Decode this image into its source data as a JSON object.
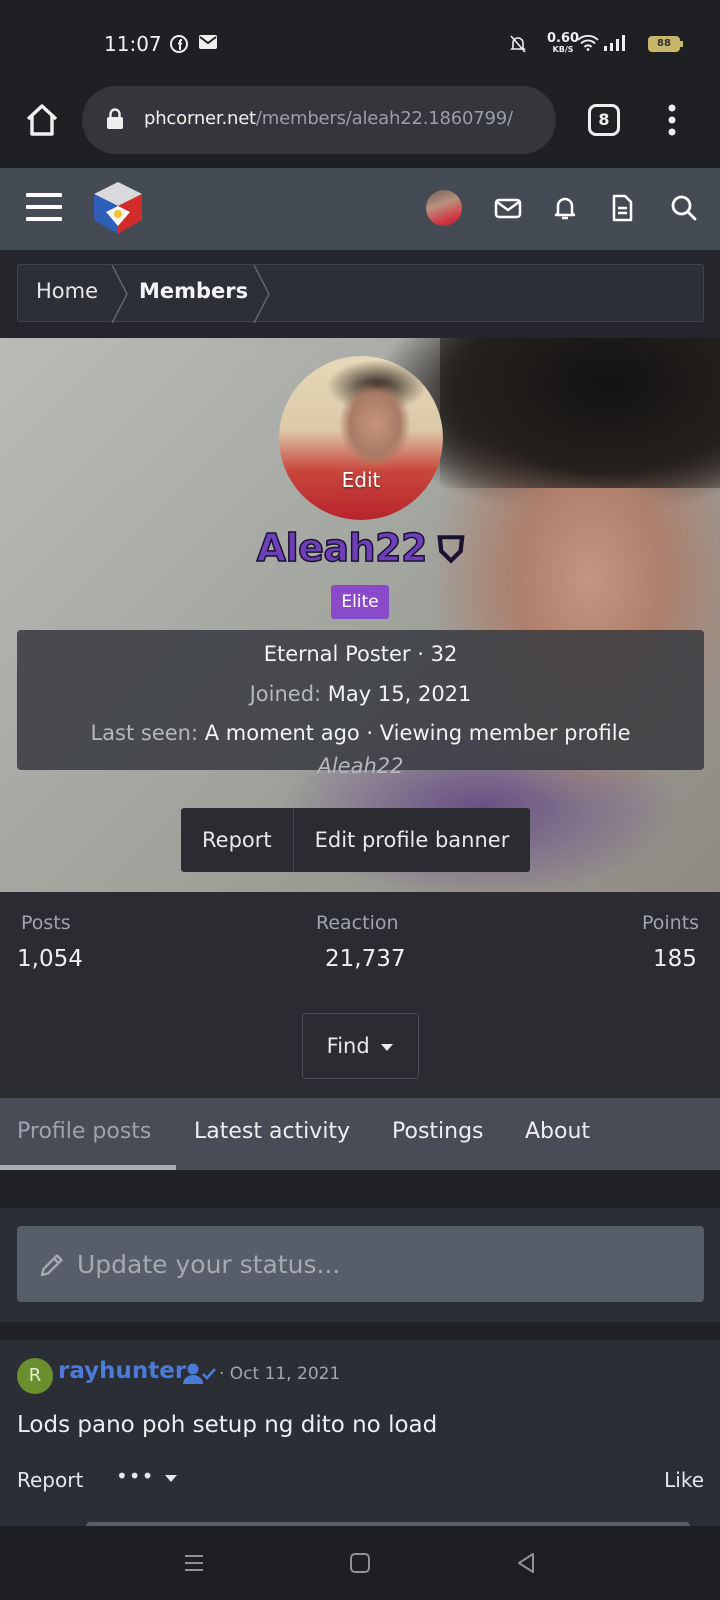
{
  "status_bar": {
    "time": "11:07",
    "notif_icons": [
      "facebook-icon",
      "mail-icon"
    ],
    "net_speed_value": "0.60",
    "net_speed_unit": "KB/S",
    "battery": "88"
  },
  "browser": {
    "url_host": "phcorner.net",
    "url_path": "/members/aleah22.1860799/",
    "tab_count": "8"
  },
  "breadcrumb": {
    "home": "Home",
    "members": "Members"
  },
  "profile": {
    "avatar_edit": "Edit",
    "username": "Aleah22",
    "badge": "Elite",
    "title_line": "Eternal Poster · 32",
    "joined_label": "Joined:",
    "joined_value": "May 15, 2021",
    "last_seen_label": "Last seen:",
    "last_seen_value": "A moment ago · Viewing member profile",
    "last_seen_target": "Aleah22",
    "report_label": "Report",
    "edit_banner_label": "Edit profile banner"
  },
  "stats": {
    "posts_label": "Posts",
    "posts_value": "1,054",
    "reaction_label": "Reaction",
    "reaction_value": "21,737",
    "points_label": "Points",
    "points_value": "185",
    "find_label": "Find"
  },
  "tabs": [
    {
      "label": "Profile posts"
    },
    {
      "label": "Latest activity"
    },
    {
      "label": "Postings"
    },
    {
      "label": "About"
    }
  ],
  "status_input": {
    "placeholder": "Update your status..."
  },
  "post": {
    "avatar_letter": "R",
    "user": "rayhunter",
    "date": "· Oct 11, 2021",
    "text": "Lods pano poh setup ng dito no load",
    "report": "Report",
    "more": "•••",
    "like": "Like"
  },
  "colors": {
    "nav_bg": "#454b55",
    "username": "#6f3fb9",
    "badge": "#8a4bc8",
    "link": "#4a7bd8"
  }
}
